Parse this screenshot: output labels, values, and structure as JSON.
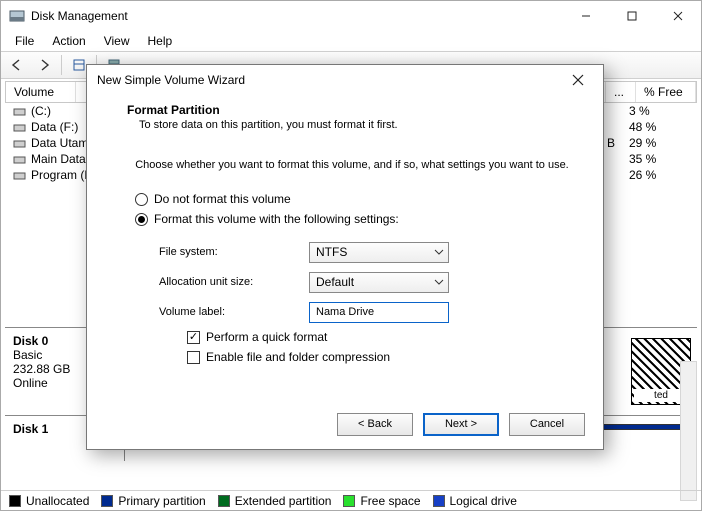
{
  "app": {
    "title": "Disk Management",
    "menu": [
      "File",
      "Action",
      "View",
      "Help"
    ]
  },
  "columns": {
    "volume": "Volume",
    "dots": "...",
    "free": "% Free"
  },
  "volumes": [
    {
      "name": "(C:)",
      "mid": "",
      "free": "3 %"
    },
    {
      "name": "Data (F:)",
      "mid": "",
      "free": "48 %"
    },
    {
      "name": "Data Utama (",
      "mid": "B",
      "free": "29 %"
    },
    {
      "name": "Main Data (D",
      "mid": "",
      "free": "35 %"
    },
    {
      "name": "Program (E:)",
      "mid": "",
      "free": "26 %"
    }
  ],
  "disk0": {
    "title": "Disk 0",
    "type": "Basic",
    "size": "232.88 GB",
    "status": "Online",
    "tag": "ted"
  },
  "disk1": {
    "title": "Disk 1"
  },
  "legend": {
    "unallocated": "Unallocated",
    "primary": "Primary partition",
    "extended": "Extended partition",
    "freespace": "Free space",
    "logical": "Logical drive"
  },
  "legend_colors": {
    "unallocated": "#000000",
    "primary": "#002a8f",
    "extended": "#006b1f",
    "freespace": "#29e02e",
    "logical": "#1740c6"
  },
  "wizard": {
    "title": "New Simple Volume Wizard",
    "heading": "Format Partition",
    "subheading": "To store data on this partition, you must format it first.",
    "instruction": "Choose whether you want to format this volume, and if so, what settings you want to use.",
    "opt_noformat": "Do not format this volume",
    "opt_format": "Format this volume with the following settings:",
    "lbl_fs": "File system:",
    "lbl_alloc": "Allocation unit size:",
    "lbl_label": "Volume label:",
    "val_fs": "NTFS",
    "val_alloc": "Default",
    "val_label": "Nama Drive",
    "chk_quick": "Perform a quick format",
    "chk_compress": "Enable file and folder compression",
    "btn_back": "< Back",
    "btn_next": "Next >",
    "btn_cancel": "Cancel"
  }
}
